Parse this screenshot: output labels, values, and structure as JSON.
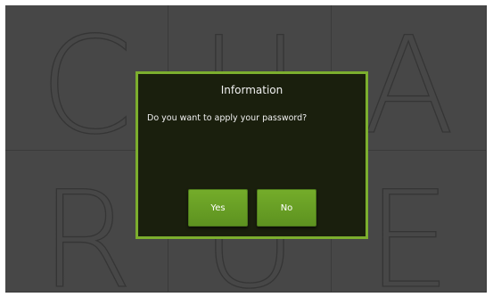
{
  "background_tiles": [
    "C",
    "U",
    "A",
    "R",
    "U",
    "E"
  ],
  "dialog": {
    "title": "Information",
    "message": "Do you want to apply your password?",
    "yes_label": "Yes",
    "no_label": "No"
  },
  "colors": {
    "accent_green": "#7cae2e",
    "button_green": "#6aa126",
    "dialog_bg": "#1a1f0d",
    "backdrop": "#474747"
  }
}
